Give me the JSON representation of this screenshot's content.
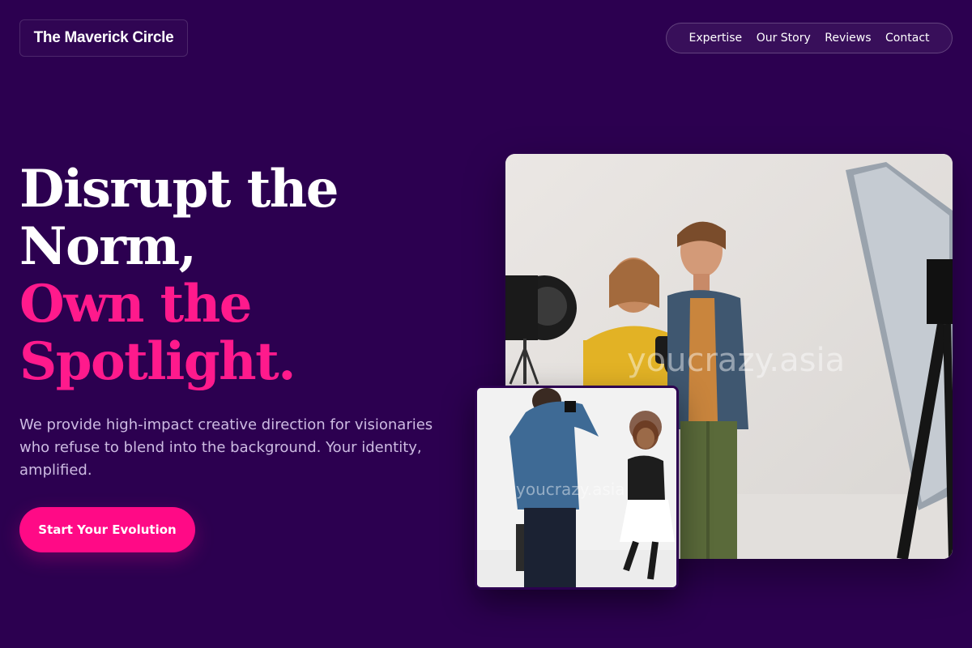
{
  "header": {
    "logo": "The Maverick Circle",
    "nav": [
      {
        "label": "Expertise"
      },
      {
        "label": "Our Story"
      },
      {
        "label": "Reviews"
      },
      {
        "label": "Contact"
      }
    ]
  },
  "hero": {
    "title_lines_white": [
      "Disrupt the",
      "Norm,"
    ],
    "title_lines_pink": [
      "Own the",
      "Spotlight."
    ],
    "description": "We provide high-impact creative direction for visionaries who refuse to blend into the background. Your identity, amplified.",
    "cta_label": "Start Your Evolution"
  },
  "images": {
    "main_watermark": "youcrazy.asia",
    "small_watermark": "youcrazy.asia"
  },
  "colors": {
    "background": "#2c0050",
    "accent_pink": "#ff0a86",
    "text_muted": "#cdbbe2"
  }
}
